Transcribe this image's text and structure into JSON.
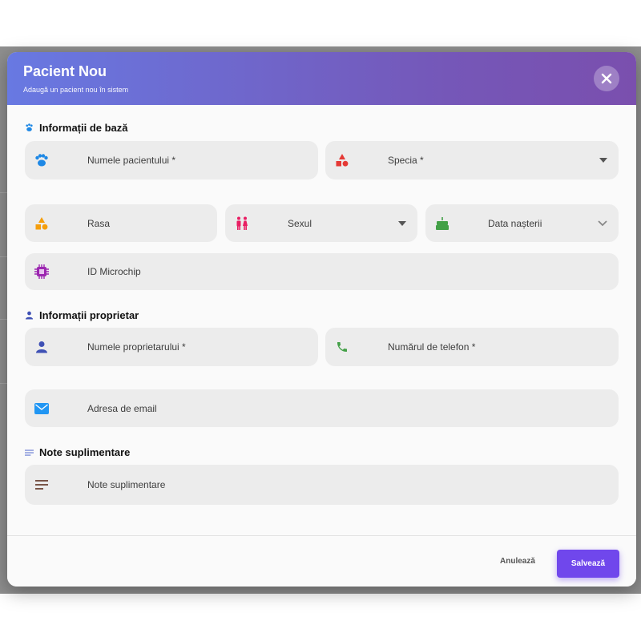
{
  "dialog": {
    "title": "Pacient Nou",
    "subtitle": "Adaugă un pacient nou în sistem"
  },
  "sections": {
    "basic": "Informații de bază",
    "owner": "Informații proprietar",
    "notes": "Note suplimentare"
  },
  "fields": {
    "patient_name": "Numele pacientului *",
    "species": "Specia *",
    "breed": "Rasa",
    "sex": "Sexul",
    "birth_date": "Data nașterii",
    "microchip": "ID Microchip",
    "owner_name": "Numele proprietarului *",
    "phone": "Numărul de telefon *",
    "email": "Adresa de email",
    "notes": "Note suplimentare"
  },
  "buttons": {
    "cancel": "Anulează",
    "save": "Salvează"
  },
  "colors": {
    "accent": "#7047ec",
    "header_start": "#6879e2",
    "header_end": "#7a4fae"
  }
}
